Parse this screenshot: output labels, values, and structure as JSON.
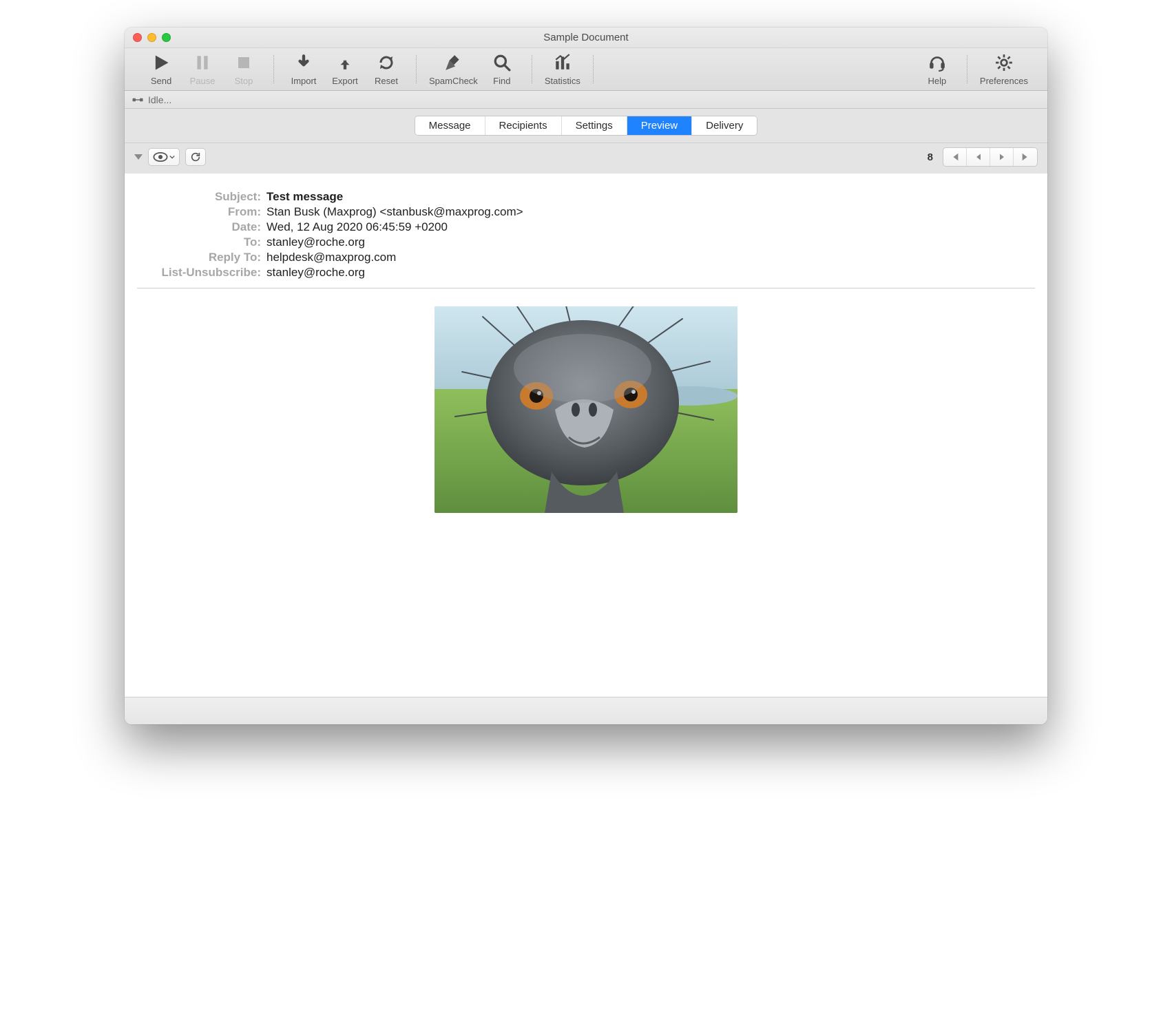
{
  "window": {
    "title": "Sample Document"
  },
  "toolbar": {
    "send": "Send",
    "pause": "Pause",
    "stop": "Stop",
    "import": "Import",
    "export": "Export",
    "reset": "Reset",
    "spamcheck": "SpamCheck",
    "find": "Find",
    "statistics": "Statistics",
    "help": "Help",
    "preferences": "Preferences"
  },
  "status": {
    "text": "Idle..."
  },
  "tabs": {
    "message": "Message",
    "recipients": "Recipients",
    "settings": "Settings",
    "preview": "Preview",
    "delivery": "Delivery",
    "active": "preview"
  },
  "preview_controls": {
    "count": "8"
  },
  "headers": {
    "labels": {
      "subject": "Subject:",
      "from": "From:",
      "date": "Date:",
      "to": "To:",
      "reply_to": "Reply To:",
      "list_unsub": "List-Unsubscribe:"
    },
    "values": {
      "subject": "Test message",
      "from": "Stan Busk (Maxprog) <stanbusk@maxprog.com>",
      "date": "Wed, 12 Aug 2020 06:45:59 +0200",
      "to": "stanley@roche.org",
      "reply_to": "helpdesk@maxprog.com",
      "list_unsub": "stanley@roche.org"
    }
  },
  "body": {
    "image_alt": "emu-photo"
  }
}
